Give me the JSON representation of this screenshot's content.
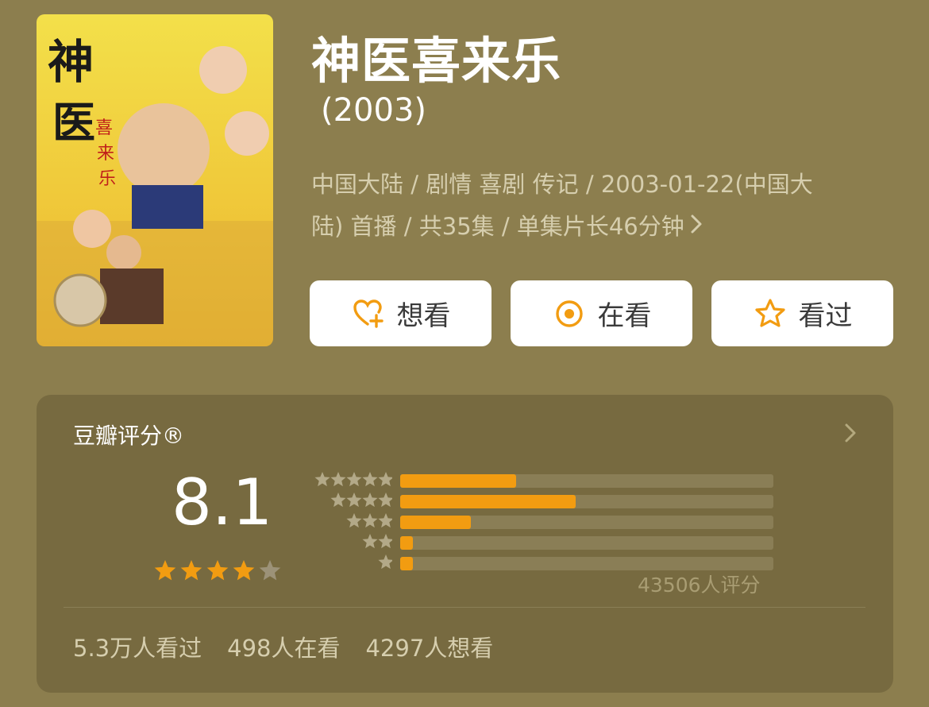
{
  "title": "神医喜来乐",
  "year": "(2003)",
  "meta": {
    "line1": "中国大陆 / 剧情 喜剧 传记 / 2003-01-22(中国大",
    "line2": "陆) 首播 / 共35集 / 单集片长46分钟"
  },
  "actions": [
    {
      "label": "想看",
      "icon": "heart-plus-icon"
    },
    {
      "label": "在看",
      "icon": "target-circle-icon"
    },
    {
      "label": "看过",
      "icon": "star-outline-icon"
    }
  ],
  "rating": {
    "header": "豆瓣评分®",
    "score": "8.1",
    "star_level": 4,
    "star_max": 5,
    "distribution": [
      {
        "stars": 5,
        "fraction": 0.31
      },
      {
        "stars": 4,
        "fraction": 0.47
      },
      {
        "stars": 3,
        "fraction": 0.19
      },
      {
        "stars": 2,
        "fraction": 0.03
      },
      {
        "stars": 1,
        "fraction": 0.03
      }
    ],
    "count_text": "43506人评分"
  },
  "stats": {
    "watched": "5.3万人看过",
    "watching": "498人在看",
    "want": "4297人想看"
  },
  "colors": {
    "background": "#8c7e4e",
    "card": "#776a40",
    "accent": "#f29c11",
    "track": "#8a7e56"
  }
}
